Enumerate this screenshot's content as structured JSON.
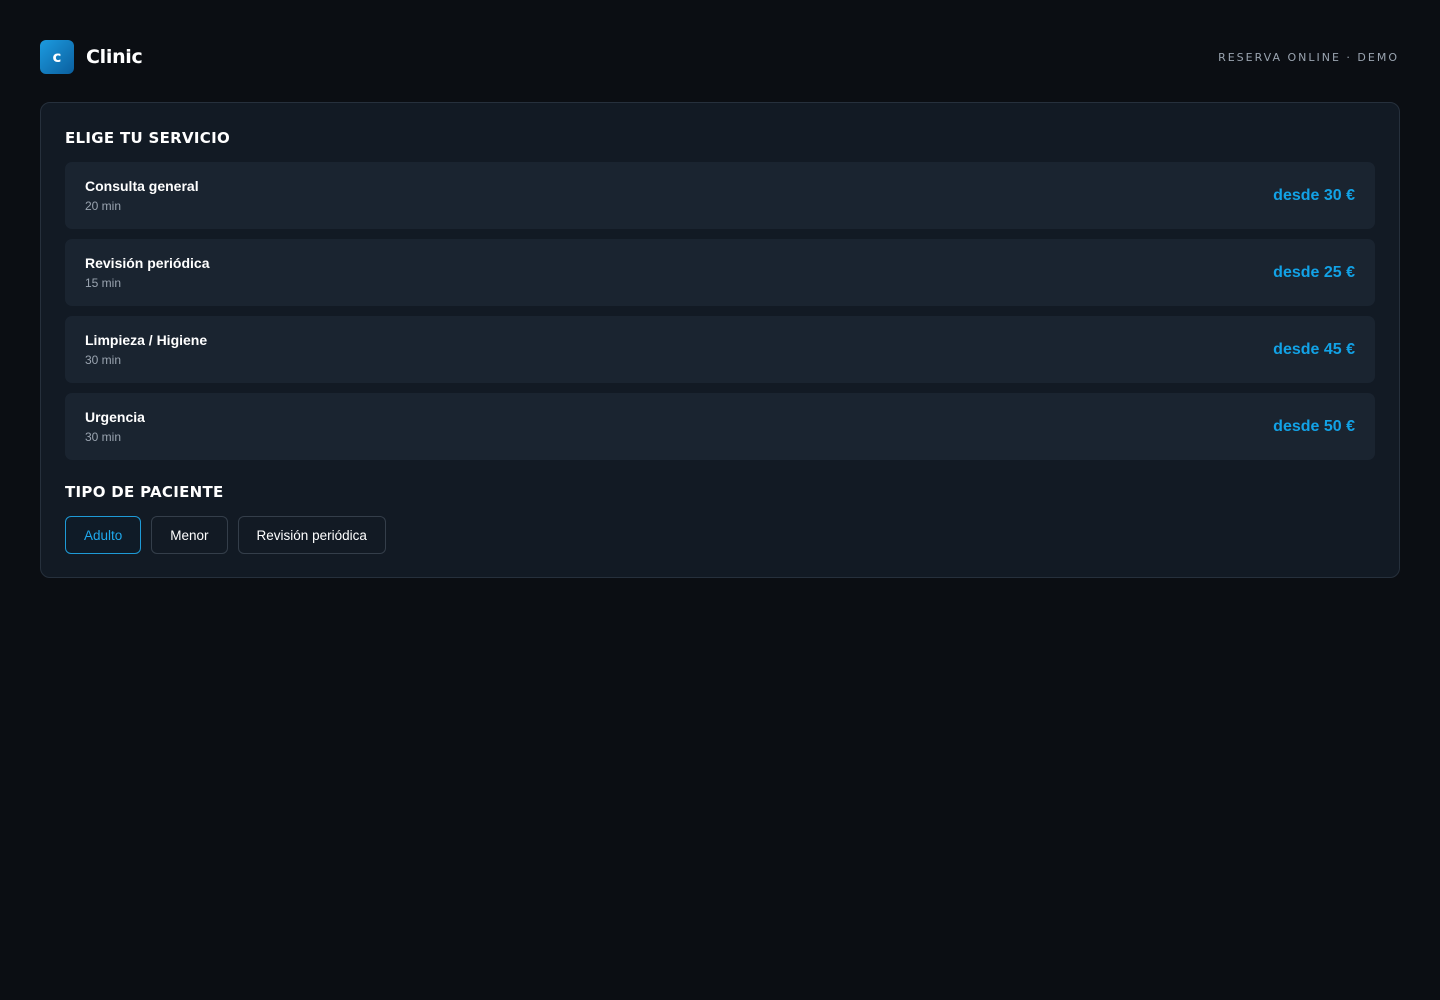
{
  "brand": {
    "logo_letter": "c",
    "name": "Clinic",
    "tag": "RESERVA ONLINE · DEMO"
  },
  "services": {
    "title": "ELIGE TU SERVICIO",
    "items": [
      {
        "name": "Consulta general",
        "duration": "20 min",
        "price": "desde 30 €"
      },
      {
        "name": "Revisión periódica",
        "duration": "15 min",
        "price": "desde 25 €"
      },
      {
        "name": "Limpieza / Higiene",
        "duration": "30 min",
        "price": "desde 45 €"
      },
      {
        "name": "Urgencia",
        "duration": "30 min",
        "price": "desde 50 €"
      }
    ]
  },
  "patient": {
    "title": "TIPO DE PACIENTE",
    "options": [
      {
        "label": "Adulto",
        "selected": true
      },
      {
        "label": "Menor",
        "selected": false
      },
      {
        "label": "Revisión periódica",
        "selected": false
      }
    ]
  },
  "colors": {
    "background": "#0b0e13",
    "panel": "#121a24",
    "card": "#1a2430",
    "accent": "#12a2e6"
  }
}
